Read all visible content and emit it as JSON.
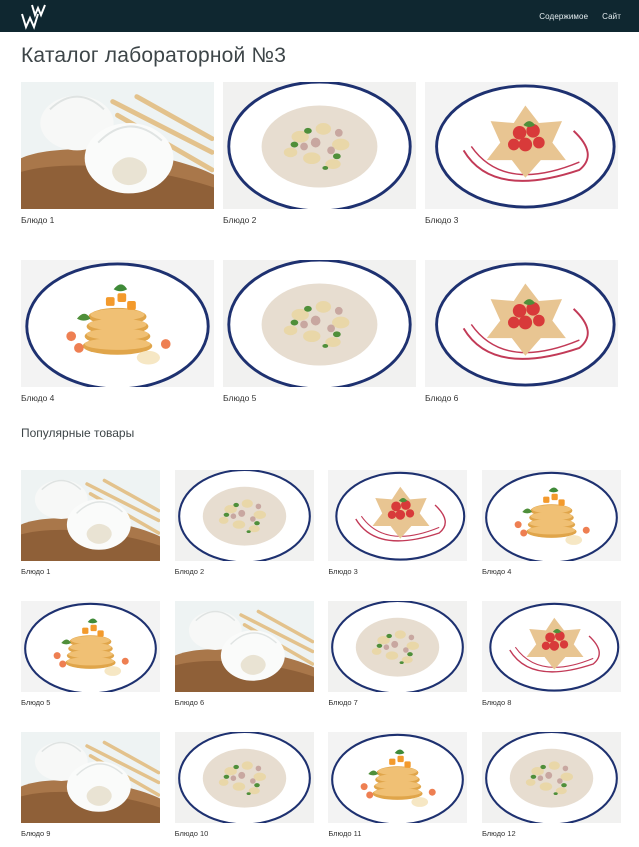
{
  "header": {
    "logo_text": "WW",
    "nav": [
      {
        "label": "Содержимое"
      },
      {
        "label": "Сайт"
      }
    ]
  },
  "page": {
    "title": "Каталог лабораторной №3"
  },
  "catalog": {
    "items": [
      {
        "label": "Блюдо 1",
        "image": "dumplings-icon"
      },
      {
        "label": "Блюдо 2",
        "image": "pasta-plate-icon"
      },
      {
        "label": "Блюдо 3",
        "image": "strawberry-tart-icon"
      },
      {
        "label": "Блюдо 4",
        "image": "pancake-stack-icon"
      },
      {
        "label": "Блюдо 5",
        "image": "pasta-plate-icon"
      },
      {
        "label": "Блюдо 6",
        "image": "strawberry-tart-icon"
      }
    ]
  },
  "popular": {
    "title": "Популярные товары",
    "items": [
      {
        "label": "Блюдо 1",
        "image": "dumplings-icon"
      },
      {
        "label": "Блюдо 2",
        "image": "pasta-plate-icon"
      },
      {
        "label": "Блюдо 3",
        "image": "strawberry-tart-icon"
      },
      {
        "label": "Блюдо 4",
        "image": "pancake-stack-icon"
      },
      {
        "label": "Блюдо 5",
        "image": "pancake-stack-icon"
      },
      {
        "label": "Блюдо 6",
        "image": "dumplings-icon"
      },
      {
        "label": "Блюдо 7",
        "image": "pasta-plate-icon"
      },
      {
        "label": "Блюдо 8",
        "image": "strawberry-tart-icon"
      },
      {
        "label": "Блюдо 9",
        "image": "dumplings-icon"
      },
      {
        "label": "Блюдо 10",
        "image": "pasta-plate-icon"
      },
      {
        "label": "Блюдо 11",
        "image": "pancake-stack-icon"
      },
      {
        "label": "Блюдо 12",
        "image": "pasta-plate-icon"
      }
    ]
  },
  "colors": {
    "header_bg": "#0f2730",
    "plate_rim": "#1e3170",
    "tart_sauce": "#c23a57"
  }
}
